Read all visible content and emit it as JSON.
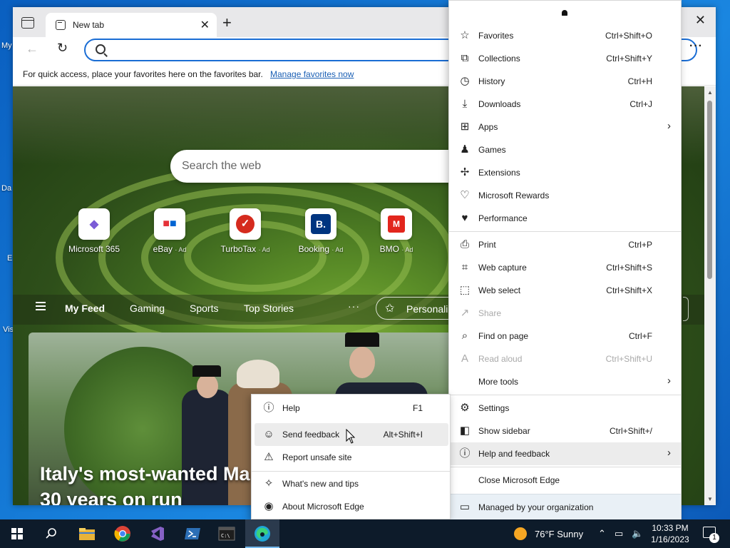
{
  "desktop": {
    "labels": [
      "My",
      "Da",
      "E",
      "Vis"
    ]
  },
  "browser": {
    "tab_title": "New tab",
    "favbar_text": "For quick access, place your favorites here on the favorites bar.",
    "favbar_link": "Manage favorites now",
    "search_placeholder": "Search the web",
    "tiles": [
      {
        "label": "Microsoft 365",
        "ad": ""
      },
      {
        "label": "eBay",
        "ad": "· Ad"
      },
      {
        "label": "TurboTax",
        "ad": "· Ad"
      },
      {
        "label": "Booking",
        "ad": "· Ad"
      },
      {
        "label": "BMO",
        "ad": "· Ad"
      }
    ],
    "feed_tabs": [
      "My Feed",
      "Gaming",
      "Sports",
      "Top Stories"
    ],
    "personalize": "Personaliz",
    "headline_line1": "Italy's most-wanted Ma",
    "headline_line2": "30 years on run"
  },
  "menu": {
    "items": [
      {
        "label": "Favorites",
        "shortcut": "Ctrl+Shift+O",
        "icon": "favorites-icon"
      },
      {
        "label": "Collections",
        "shortcut": "Ctrl+Shift+Y",
        "icon": "collections-icon"
      },
      {
        "label": "History",
        "shortcut": "Ctrl+H",
        "icon": "history-icon"
      },
      {
        "label": "Downloads",
        "shortcut": "Ctrl+J",
        "icon": "download-icon"
      },
      {
        "label": "Apps",
        "shortcut": "",
        "icon": "apps-icon"
      },
      {
        "label": "Games",
        "shortcut": "",
        "icon": "games-icon"
      },
      {
        "label": "Extensions",
        "shortcut": "",
        "icon": "extensions-icon"
      },
      {
        "label": "Microsoft Rewards",
        "shortcut": "",
        "icon": "rewards-icon"
      },
      {
        "label": "Performance",
        "shortcut": "",
        "icon": "performance-icon"
      },
      {
        "label": "Print",
        "shortcut": "Ctrl+P",
        "icon": "print-icon"
      },
      {
        "label": "Web capture",
        "shortcut": "Ctrl+Shift+S",
        "icon": "web-capture-icon"
      },
      {
        "label": "Web select",
        "shortcut": "Ctrl+Shift+X",
        "icon": "web-select-icon"
      },
      {
        "label": "Share",
        "shortcut": "",
        "icon": "share-icon"
      },
      {
        "label": "Find on page",
        "shortcut": "Ctrl+F",
        "icon": "find-icon"
      },
      {
        "label": "Read aloud",
        "shortcut": "Ctrl+Shift+U",
        "icon": "read-aloud-icon"
      },
      {
        "label": "More tools",
        "shortcut": "",
        "icon": ""
      },
      {
        "label": "Settings",
        "shortcut": "",
        "icon": "settings-icon"
      },
      {
        "label": "Show sidebar",
        "shortcut": "Ctrl+Shift+/",
        "icon": "sidebar-icon"
      },
      {
        "label": "Help and feedback",
        "shortcut": "",
        "icon": "help-icon"
      },
      {
        "label": "Close Microsoft Edge",
        "shortcut": "",
        "icon": ""
      },
      {
        "label": "Managed by your organization",
        "shortcut": "",
        "icon": "briefcase-icon"
      }
    ]
  },
  "submenu": {
    "items": [
      {
        "label": "Help",
        "shortcut": "F1",
        "icon": "help-icon"
      },
      {
        "label": "Send feedback",
        "shortcut": "Alt+Shift+I",
        "icon": "feedback-icon"
      },
      {
        "label": "Report unsafe site",
        "shortcut": "",
        "icon": "warning-icon"
      },
      {
        "label": "What's new and tips",
        "shortcut": "",
        "icon": "tips-icon"
      },
      {
        "label": "About Microsoft Edge",
        "shortcut": "",
        "icon": "edge-icon"
      }
    ]
  },
  "taskbar": {
    "weather": "76°F  Sunny",
    "time": "10:33 PM",
    "date": "1/16/2023",
    "notifications": "1"
  },
  "colors": {
    "accent": "#1a6dd4",
    "taskbar": "#0d1b2a",
    "menu_highlight": "#ececec"
  }
}
